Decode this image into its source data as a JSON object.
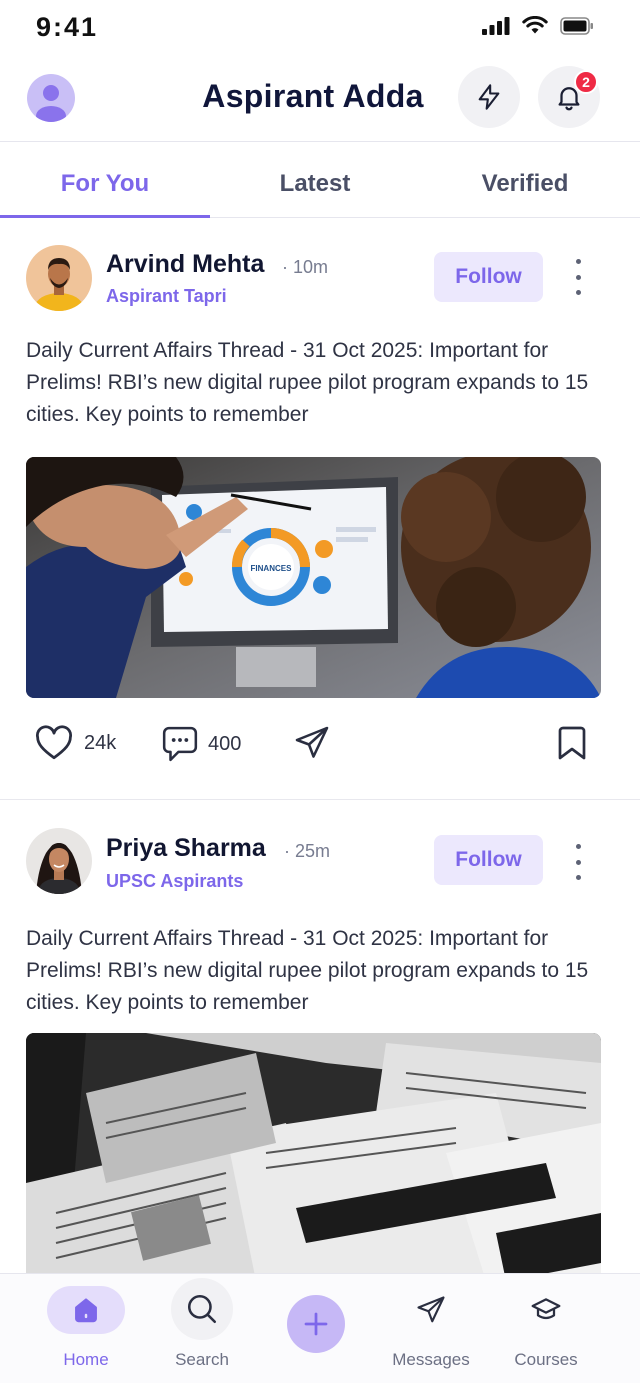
{
  "status_bar": {
    "time": "9:41"
  },
  "header": {
    "title": "Aspirant Adda",
    "notification_count": "2"
  },
  "tabs": [
    {
      "label": "For You",
      "active": true
    },
    {
      "label": "Latest",
      "active": false
    },
    {
      "label": "Verified",
      "active": false
    }
  ],
  "posts": [
    {
      "author": "Arvind Mehta",
      "time": "· 10m",
      "group": "Aspirant Tapri",
      "follow_label": "Follow",
      "text": "Daily Current Affairs Thread - 31 Oct 2025: Important for Prelims! RBI’s new digital rupee pilot program expands to 15 cities. Key points to remember",
      "image_text": "FINANCES",
      "likes": "24k",
      "comments": "400"
    },
    {
      "author": "Priya Sharma",
      "time": "· 25m",
      "group": "UPSC Aspirants",
      "follow_label": "Follow",
      "text": "Daily Current Affairs Thread - 31 Oct 2025: Important for Prelims! RBI’s new digital rupee pilot program expands to 15 cities. Key points to remember"
    }
  ],
  "bottom_nav": {
    "home": "Home",
    "search": "Search",
    "messages": "Messages",
    "courses": "Courses"
  },
  "colors": {
    "accent": "#7d67ea",
    "accent_light": "#ece8fd",
    "badge": "#ef2b45",
    "text_dark": "#111631"
  }
}
